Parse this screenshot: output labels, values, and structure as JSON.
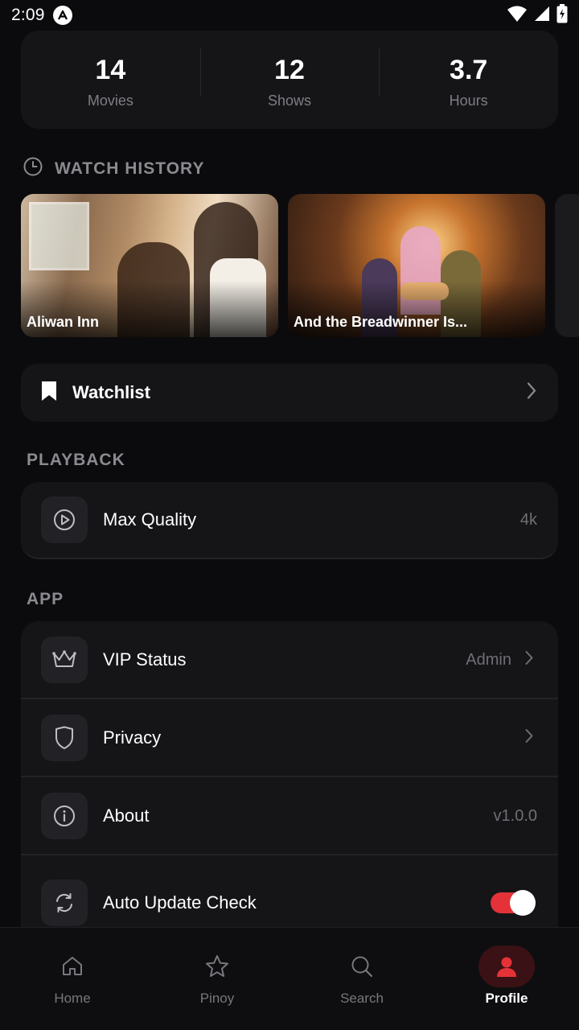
{
  "status_bar": {
    "time": "2:09"
  },
  "stats": [
    {
      "value": "14",
      "label": "Movies"
    },
    {
      "value": "12",
      "label": "Shows"
    },
    {
      "value": "3.7",
      "label": "Hours"
    }
  ],
  "watch_history": {
    "heading": "WATCH HISTORY",
    "items": [
      {
        "title": "Aliwan Inn"
      },
      {
        "title": "And the Breadwinner Is..."
      }
    ]
  },
  "watchlist": {
    "label": "Watchlist"
  },
  "playback": {
    "heading": "PLAYBACK",
    "max_quality": {
      "label": "Max Quality",
      "value": "4k"
    }
  },
  "app": {
    "heading": "APP",
    "vip": {
      "label": "VIP Status",
      "value": "Admin"
    },
    "privacy": {
      "label": "Privacy"
    },
    "about": {
      "label": "About",
      "value": "v1.0.0"
    },
    "auto_update": {
      "label": "Auto Update Check",
      "enabled": true
    }
  },
  "nav": {
    "items": [
      {
        "label": "Home",
        "icon": "home-icon"
      },
      {
        "label": "Pinoy",
        "icon": "star-icon"
      },
      {
        "label": "Search",
        "icon": "search-icon"
      },
      {
        "label": "Profile",
        "icon": "person-icon"
      }
    ],
    "active": "Profile"
  },
  "colors": {
    "accent": "#e53238",
    "background": "#0b0b0d",
    "card": "#151518"
  }
}
